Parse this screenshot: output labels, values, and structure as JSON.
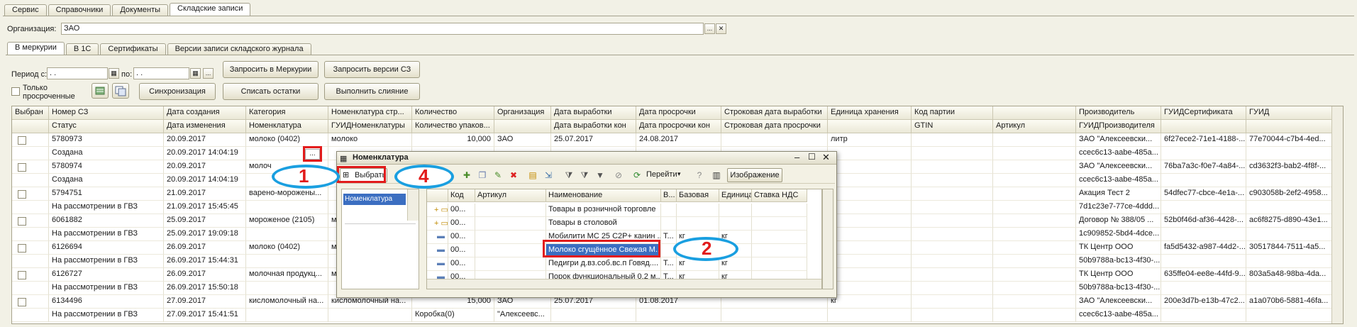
{
  "top_tabs": [
    "Сервис",
    "Справочники",
    "Документы",
    "Складские записи"
  ],
  "org": {
    "label": "Организация:",
    "value": "ЗАО",
    "select": "...",
    "clear": "✕"
  },
  "sub_tabs": [
    "В меркурии",
    "В 1С",
    "Сертификаты",
    "Версии записи складского журнала"
  ],
  "filter": {
    "period_label": "Период с:",
    "period_from": ". .",
    "to_label": "по:",
    "period_to": ". .",
    "only_overdue": "Только просроченные",
    "buttons": {
      "query_mercury": "Запросить в Меркурии",
      "query_versions": "Запросить версии СЗ",
      "sync": "Синхронизация",
      "write_off": "Списать остатки",
      "merge": "Выполнить слияние"
    }
  },
  "grid": {
    "headers_row1": [
      "Выбран",
      "Номер СЗ",
      "Дата создания",
      "Категория",
      "Номенклатура стр...",
      "Количество",
      "Организация",
      "Дата выработки",
      "Дата просрочки",
      "Строковая дата выработки",
      "Единица хранения",
      "Код партии",
      "",
      "Производитель",
      "ГУИДСертификата",
      "ГУИД"
    ],
    "headers_row2": [
      "",
      "Статус",
      "Дата изменения",
      "Номенклатура",
      "ГУИДНоменклатуры",
      "Количество упаков...",
      "",
      "Дата выработки кон",
      "Дата просрочки кон",
      "Строковая дата просрочки",
      "",
      "GTIN",
      "Артикул",
      "ГУИДПроизводителя",
      "",
      ""
    ],
    "rows": [
      {
        "num": "5780973",
        "status": "Создана",
        "created": "20.09.2017",
        "changed": "20.09.2017 14:04:19",
        "category": "молоко (0402)",
        "nomen": "",
        "nomen_str": "молоко",
        "qty": "10,000",
        "pack": "",
        "org": "ЗАО",
        "org2": "",
        "prod_date": "25.07.2017",
        "exp_date": "24.08.2017",
        "unit": "литр",
        "producer": "ЗАО \"Алексеевски...",
        "producer_guid": "ccec6c13-aabe-485a...",
        "cert_guid": "6f27ece2-71e1-4188-...",
        "guid": "77e70044-c7b4-4ed..."
      },
      {
        "num": "5780974",
        "status": "Создана",
        "created": "20.09.2017",
        "changed": "20.09.2017 14:04:19",
        "category": "молоч",
        "nomen": "",
        "nomen_str": "",
        "qty": "",
        "pack": "",
        "org": "",
        "org2": "",
        "prod_date": "",
        "exp_date": "",
        "unit": "",
        "producer": "ЗАО \"Алексеевски...",
        "producer_guid": "ccec6c13-aabe-485a...",
        "cert_guid": "76ba7a3c-f0e7-4a84-...",
        "guid": "cd3632f3-bab2-4f8f-..."
      },
      {
        "num": "5794751",
        "status": "На рассмотрении в ГВЗ",
        "created": "21.09.2017",
        "changed": "21.09.2017 15:45:45",
        "category": "варено-морожены...",
        "nomen": "",
        "nomen_str": "",
        "qty": "",
        "pack": "",
        "org": "",
        "org2": "",
        "prod_date": "",
        "exp_date": "",
        "unit": "",
        "producer": "Акация Тест 2",
        "producer_guid": "7d1c23e7-77ce-4ddd...",
        "cert_guid": "54dfec77-cbce-4e1a-...",
        "guid": "c903058b-2ef2-4958..."
      },
      {
        "num": "6061882",
        "status": "На рассмотрении в ГВЗ",
        "created": "25.09.2017",
        "changed": "25.09.2017 19:09:18",
        "category": "мороженое (2105)",
        "nomen": "",
        "nomen_str": "м",
        "qty": "",
        "pack": "",
        "org": "",
        "org2": "",
        "prod_date": "",
        "exp_date": "",
        "unit": "",
        "producer": "Договор № 388/05 ...",
        "producer_guid": "1c909852-5bd4-4dce...",
        "cert_guid": "52b0f46d-af36-4428-...",
        "guid": "ac6f8275-d890-43e1..."
      },
      {
        "num": "6126694",
        "status": "На рассмотрении в ГВЗ",
        "created": "26.09.2017",
        "changed": "26.09.2017 15:44:31",
        "category": "молоко (0402)",
        "nomen": "",
        "nomen_str": "м",
        "qty": "",
        "pack": "",
        "org": "",
        "org2": "",
        "prod_date": "",
        "exp_date": "",
        "unit": "",
        "producer": "ТК Центр ООО",
        "producer_guid": "50b9788a-bc13-4f30-...",
        "cert_guid": "fa5d5432-a987-44d2-...",
        "guid": "30517844-7511-4a5..."
      },
      {
        "num": "6126727",
        "status": "На рассмотрении в ГВЗ",
        "created": "26.09.2017",
        "changed": "26.09.2017 15:50:18",
        "category": "молочная продукц...",
        "nomen": "",
        "nomen_str": "м",
        "qty": "",
        "pack": "",
        "org": "",
        "org2": "",
        "prod_date": "",
        "exp_date": "",
        "unit": "",
        "producer": "ТК Центр ООО",
        "producer_guid": "50b9788a-bc13-4f30-...",
        "cert_guid": "635ffe04-ee8e-44fd-9...",
        "guid": "803a5a48-98ba-4da..."
      },
      {
        "num": "6134496",
        "status": "На рассмотрении в ГВЗ",
        "created": "27.09.2017",
        "changed": "27.09.2017 15:41:51",
        "category": "кисломолочный на...",
        "nomen": "",
        "nomen_str": "кисломолочный на...",
        "qty": "15,000",
        "pack": "Коробка(0)",
        "org": "ЗАО",
        "org2": "\"Алексеевс...",
        "prod_date": "25.07.2017",
        "exp_date": "01.08.2017",
        "unit": "кг",
        "producer": "ЗАО \"Алексеевски...",
        "producer_guid": "ccec6c13-aabe-485a...",
        "cert_guid": "200e3d7b-e13b-47c2...",
        "guid": "a1a070b6-5881-46fa..."
      }
    ]
  },
  "dialog": {
    "title": "Номенклатура",
    "select_btn": "Выбрать",
    "goto": "Перейти",
    "image_btn": "Изображение",
    "tree_item": "Номенклатура",
    "headers": [
      "",
      "Код",
      "Артикул",
      "Наименование",
      "В...",
      "Базовая",
      "Единица",
      "Ставка НДС"
    ],
    "rows": [
      {
        "kind": "folder",
        "code": "00...",
        "name": "Товары в розничной торговле",
        "v": "",
        "base": "",
        "unit": ""
      },
      {
        "kind": "folder",
        "code": "00...",
        "name": "Товары в столовой",
        "v": "",
        "base": "",
        "unit": ""
      },
      {
        "kind": "item",
        "code": "00...",
        "name": "Мобилити МС 25 С2Р+ канин ...",
        "v": "Т...",
        "base": "кг",
        "unit": "кг"
      },
      {
        "kind": "item",
        "code": "00...",
        "name": "Молоко сгущённое Свежая М...",
        "v": "",
        "base": "",
        "unit": ""
      },
      {
        "kind": "item",
        "code": "00...",
        "name": "Педигри д.вз.соб.вс.п Говяд....",
        "v": "Т...",
        "base": "кг",
        "unit": "кг"
      },
      {
        "kind": "item",
        "code": "00...",
        "name": "Порок функциональный 0.2 м...",
        "v": "Т...",
        "base": "кг",
        "unit": "кг"
      }
    ]
  },
  "annotations": {
    "n1": "1",
    "n2": "2",
    "n4": "4",
    "color_red": "#e21b1b",
    "color_blue": "#1a9fe0"
  }
}
